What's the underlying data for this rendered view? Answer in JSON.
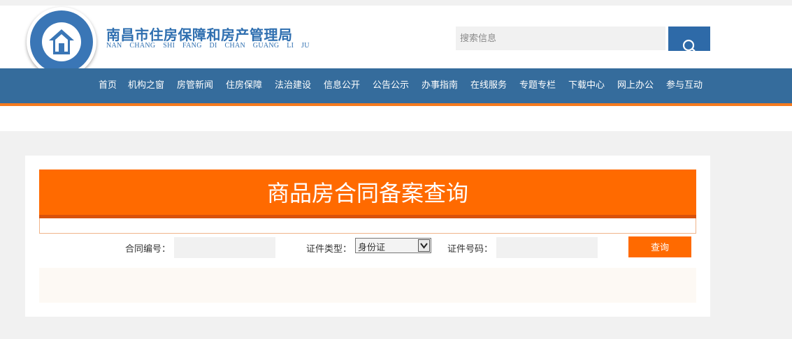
{
  "header": {
    "site_title": "南昌市住房保障和房产管理局",
    "site_pinyin": "NAN CHANG SHI FANG DI CHAN GUANG LI JU",
    "logo_icon": "house-logo-icon",
    "search": {
      "placeholder": "搜索信息",
      "button_icon": "search-icon"
    }
  },
  "nav": {
    "items": [
      "首页",
      "机构之窗",
      "房管新闻",
      "住房保障",
      "法治建设",
      "信息公开",
      "公告公示",
      "办事指南",
      "在线服务",
      "专题专栏",
      "下载中心",
      "网上办公",
      "参与互动"
    ]
  },
  "query": {
    "title": "商品房合同备案查询",
    "contract_label": "合同编号：",
    "cert_type_label": "证件类型：",
    "cert_type_value": "身份证",
    "cert_no_label": "证件号码：",
    "submit_label": "查询"
  },
  "colors": {
    "brand_blue": "#356c9c",
    "accent_orange": "#ff6a00"
  }
}
